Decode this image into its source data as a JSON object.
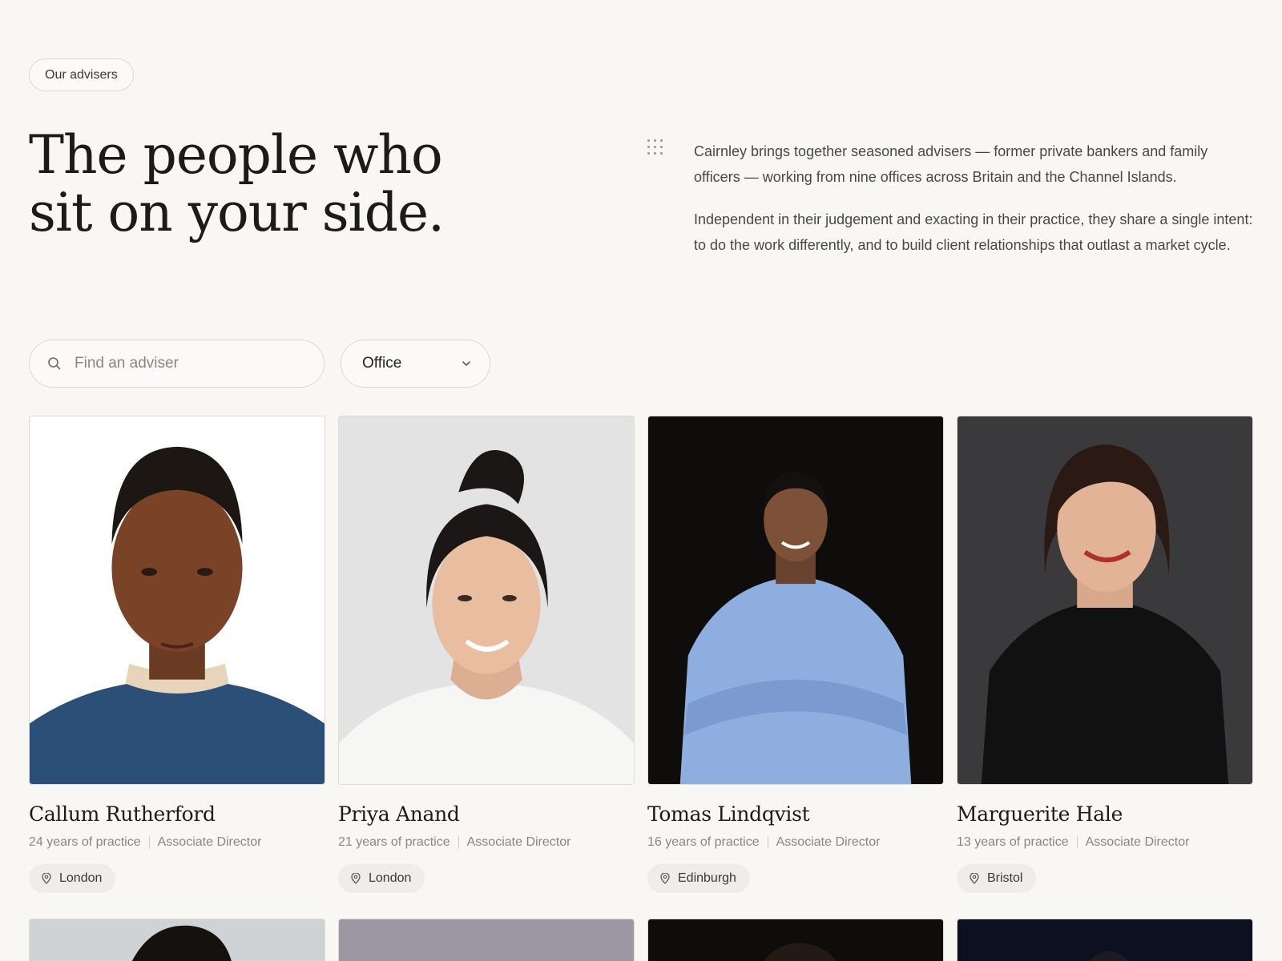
{
  "section_tag": "Our advisers",
  "headline": {
    "line1": "The people who",
    "line2": "sit on your side."
  },
  "intro": {
    "p1": "Cairnley brings together seasoned advisers — former private bankers and family officers — working from nine offices across Britain and the Channel Islands.",
    "p2": "Independent in their judgement and exacting in their practice, they share a single intent: to do the work differently, and to build client relationships that outlast a market cycle."
  },
  "filters": {
    "search_placeholder": "Find an adviser",
    "office_label": "Office"
  },
  "advisers": [
    {
      "name": "Callum Rutherford",
      "years": "24 years of practice",
      "role": "Associate Director",
      "office": "London"
    },
    {
      "name": "Priya Anand",
      "years": "21 years of practice",
      "role": "Associate Director",
      "office": "London"
    },
    {
      "name": "Tomas Lindqvist",
      "years": "16 years of practice",
      "role": "Associate Director",
      "office": "Edinburgh"
    },
    {
      "name": "Marguerite Hale",
      "years": "13 years of practice",
      "role": "Associate Director",
      "office": "Bristol"
    }
  ],
  "colors": {
    "background": "#f8f7f4",
    "text": "#1c1b19",
    "muted": "#8a8780",
    "chip": "#efede9"
  }
}
